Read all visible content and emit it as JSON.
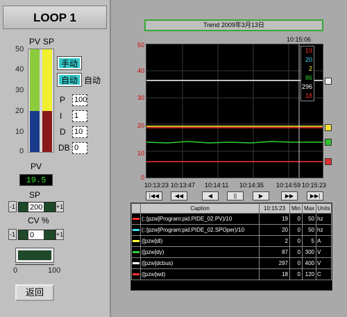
{
  "loop": {
    "title": "LOOP 1",
    "pv_label": "PV",
    "sp_label": "SP",
    "scale_ticks": [
      "50",
      "40",
      "30",
      "20",
      "10",
      "0"
    ],
    "manual_button": "手动",
    "auto_button": "自动",
    "mode_text": "自动",
    "params": [
      {
        "label": "P",
        "value": "100"
      },
      {
        "label": "I",
        "value": "1"
      },
      {
        "label": "D",
        "value": "10"
      },
      {
        "label": "DB",
        "value": "0"
      }
    ],
    "pv_display_label": "PV",
    "pv_value": "19.5",
    "sp_slider": {
      "label": "SP",
      "value": "200",
      "minus": "-1",
      "plus": "+1"
    },
    "cv_slider": {
      "label": "CV %",
      "value": "0",
      "minus": "-1",
      "plus": "+1"
    },
    "cv_scale": {
      "min": "0",
      "max": "100"
    },
    "pv_bar_level": 0.4,
    "sp_bar_level": 0.4,
    "back_button": "返回"
  },
  "trend": {
    "title": "Trend     2009年3月13日",
    "cursor_time": "10:15:06",
    "y_ticks": [
      "50",
      "40",
      "30",
      "20",
      "10",
      "0"
    ],
    "x_labels": [
      "10:13:23",
      "10:13:47",
      "10:14:11",
      "10:14:35",
      "10:14:59",
      "10:15:23"
    ],
    "cursor_values": [
      {
        "text": "19",
        "color": "#ff3030"
      },
      {
        "text": "20",
        "color": "#40e0ff"
      },
      {
        "text": "2",
        "color": "#ffff30"
      },
      {
        "text": "86",
        "color": "#30d030"
      },
      {
        "text": "296",
        "color": "#ffffff"
      },
      {
        "text": "18",
        "color": "#ff3030"
      }
    ],
    "nav_buttons": [
      "|◀◀",
      "◀◀",
      "◀",
      "||",
      "▶",
      "▶▶",
      "▶▶|"
    ]
  },
  "table": {
    "headers": [
      "Caption",
      "10:15:23",
      "Min",
      "Max",
      "Units"
    ],
    "rows": [
      {
        "color": "#ff3030",
        "caption": "(::[pzw]Program:pid.PIDE_02.PV)/10",
        "value": "19",
        "min": "0",
        "max": "50",
        "units": "hz"
      },
      {
        "color": "#40e0ff",
        "caption": "(::[pzw]Program:pid.PIDE_02.SPOper)/10",
        "value": "20",
        "min": "0",
        "max": "50",
        "units": "hz"
      },
      {
        "color": "#ffff30",
        "caption": "([pzw]dl)",
        "value": "2",
        "min": "0",
        "max": "5",
        "units": "A"
      },
      {
        "color": "#30d030",
        "caption": "([pzw]dy)",
        "value": "87",
        "min": "0",
        "max": "300",
        "units": "V"
      },
      {
        "color": "#ffffff",
        "caption": "([pzw]dcbus)",
        "value": "297",
        "min": "0",
        "max": "400",
        "units": "V"
      },
      {
        "color": "#ff3030",
        "caption": "([pzw]wd)",
        "value": "18",
        "min": "0",
        "max": "120",
        "units": "C"
      }
    ]
  }
}
